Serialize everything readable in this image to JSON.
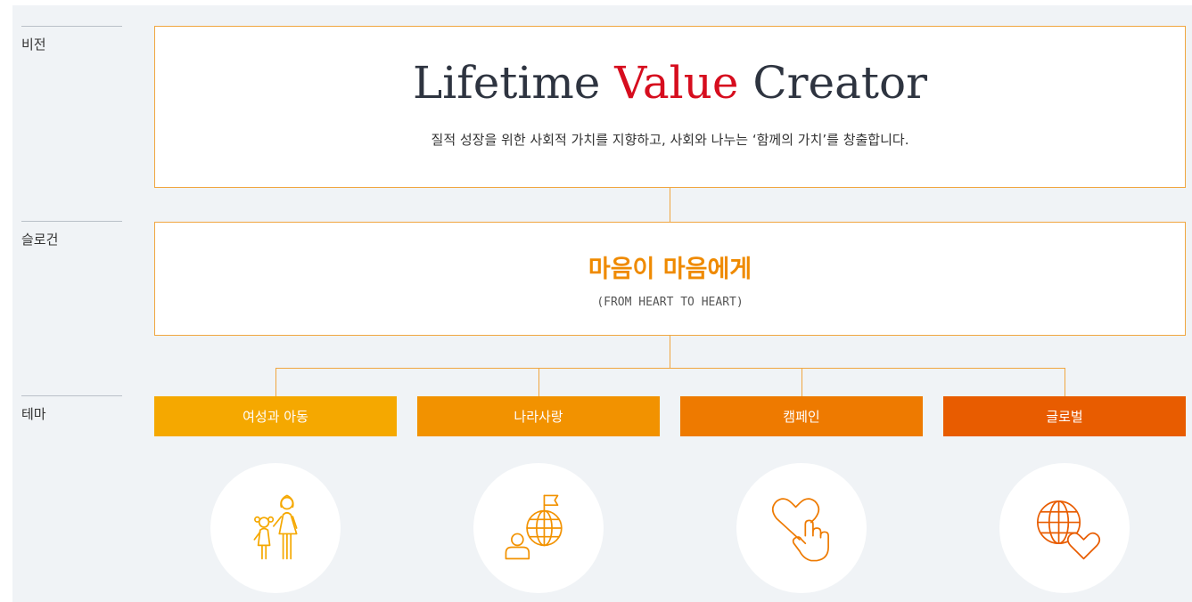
{
  "labels": {
    "vision": "비전",
    "slogan": "슬로건",
    "theme": "테마"
  },
  "vision": {
    "title_part1": "Lifetime ",
    "title_accent": "Value",
    "title_part2": " Creator",
    "subtitle": "질적 성장을 위한 사회적 가치를 지향하고, 사회와 나누는 ‘함께의 가치’를 창출합니다."
  },
  "slogan": {
    "title": "마음이 마음에게",
    "subtitle": "(FROM HEART TO HEART)"
  },
  "themes": [
    {
      "label": "여성과 아동",
      "color": "#f5a800",
      "icon": "woman-child-icon"
    },
    {
      "label": "나라사랑",
      "color": "#f29200",
      "icon": "globe-flag-person-icon"
    },
    {
      "label": "캠페인",
      "color": "#ee7a00",
      "icon": "heart-hand-icon"
    },
    {
      "label": "글로벌",
      "color": "#e85c00",
      "icon": "globe-heart-icon"
    }
  ],
  "colors": {
    "accent_red": "#d60d1e",
    "line_orange": "#f0a640",
    "slogan_orange": "#ef8a00"
  }
}
